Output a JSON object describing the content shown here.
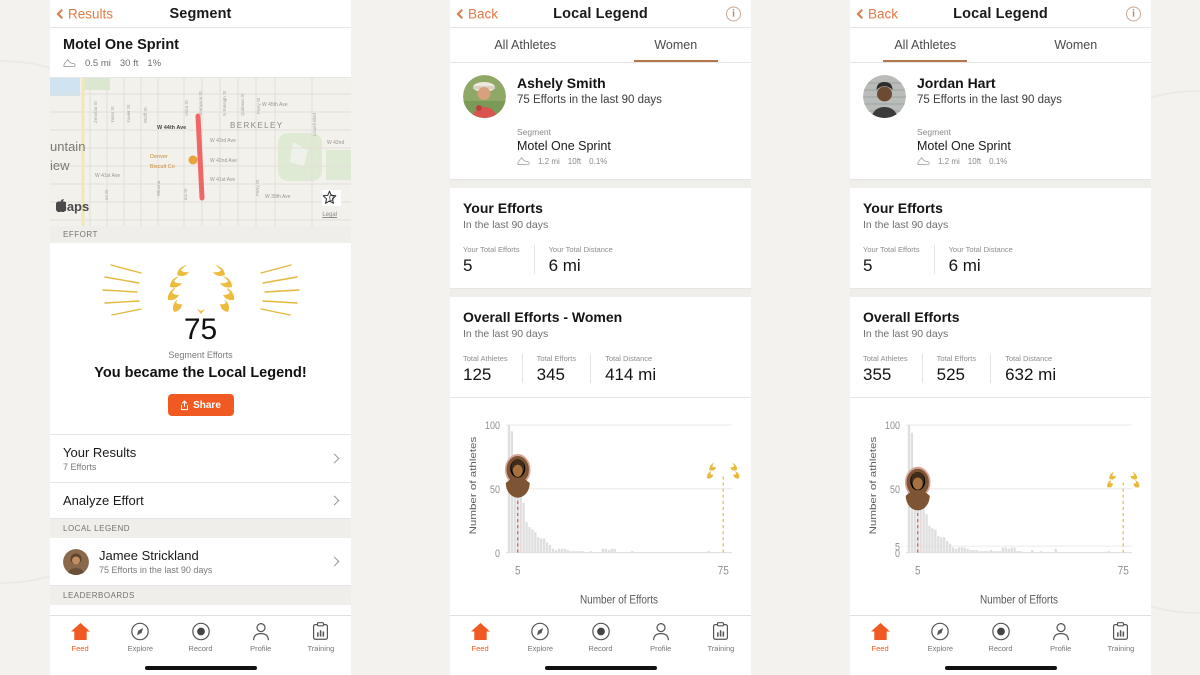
{
  "brand": {
    "orange": "#f05a22",
    "accent_brown": "#b4754a",
    "gold": "#e8b93a",
    "bar_gray": "#dcdcdc"
  },
  "left_panel": {
    "nav": {
      "back_label": "Results",
      "title": "Segment"
    },
    "segment": {
      "name": "Motel One Sprint",
      "distance": "0.5 mi",
      "elevation": "30 ft",
      "grade": "1%"
    },
    "map": {
      "attribution": "Maps",
      "legal": "Legal",
      "star_count": "0",
      "place_label": "BERKELEY",
      "city_label_1": "untain",
      "city_label_2": "iew",
      "poi": "Denver Biscuit Co",
      "streets": [
        "W 45th Ave",
        "W 44th Ave",
        "W 43rd Ave",
        "W 42nd Ave",
        "W 41st Ave",
        "W 39th Ave",
        "W 42nd",
        "Ave"
      ],
      "cross_streets": [
        "Zenobia St",
        "Yates St",
        "Xavier St",
        "Wolff St",
        "Utica St",
        "Tennyson St",
        "N Raleigh St",
        "Quitman St",
        "Perry St",
        "Lowell Blvd",
        "Winona",
        "Perry St",
        "Ves St",
        "Ica St"
      ]
    },
    "effort_header": "EFFORT",
    "trophy": {
      "count": "75",
      "count_label": "Segment Efforts",
      "headline": "You became the Local Legend!",
      "share_label": "Share"
    },
    "rows": [
      {
        "title": "Your Results",
        "sub": "7 Efforts"
      },
      {
        "title": "Analyze Effort",
        "sub": ""
      }
    ],
    "local_legend_header": "LOCAL LEGEND",
    "local_legend": {
      "name": "Jamee Strickland",
      "sub": "75 Efforts in the last 90 days"
    },
    "leaderboards_header": "LEADERBOARDS",
    "tabbar": [
      {
        "label": "Feed",
        "icon": "home-icon",
        "active": true
      },
      {
        "label": "Explore",
        "icon": "compass-icon",
        "active": false
      },
      {
        "label": "Record",
        "icon": "record-icon",
        "active": false
      },
      {
        "label": "Profile",
        "icon": "person-icon",
        "active": false
      },
      {
        "label": "Training",
        "icon": "clipboard-icon",
        "active": false
      }
    ]
  },
  "mid_panel": {
    "nav": {
      "back_label": "Back",
      "title": "Local Legend",
      "info": "i"
    },
    "tabs": [
      {
        "label": "All Athletes",
        "active": false
      },
      {
        "label": "Women",
        "active": true
      }
    ],
    "athlete": {
      "name": "Ashely Smith",
      "sub": "75 Efforts in the last 90 days",
      "segment_label": "Segment",
      "segment_name": "Motel One Sprint",
      "distance": "1.2 mi",
      "elevation": "10ft",
      "grade": "0.1%"
    },
    "your_efforts": {
      "title": "Your Efforts",
      "subtitle": "In the last 90 days",
      "stats": [
        {
          "label": "Your Total Efforts",
          "value": "5"
        },
        {
          "label": "Your Total Distance",
          "value": "6 mi"
        }
      ]
    },
    "overall": {
      "title": "Overall Efforts - Women",
      "subtitle": "In the last 90 days",
      "stats": [
        {
          "label": "Total Athletes",
          "value": "125"
        },
        {
          "label": "Total Efforts",
          "value": "345"
        },
        {
          "label": "Total Distance",
          "value": "414 mi"
        }
      ]
    },
    "tabbar": [
      {
        "label": "Feed",
        "icon": "home-icon",
        "active": true
      },
      {
        "label": "Explore",
        "icon": "compass-icon",
        "active": false
      },
      {
        "label": "Record",
        "icon": "record-icon",
        "active": false
      },
      {
        "label": "Profile",
        "icon": "person-icon",
        "active": false
      },
      {
        "label": "Training",
        "icon": "clipboard-icon",
        "active": false
      }
    ]
  },
  "right_panel": {
    "nav": {
      "back_label": "Back",
      "title": "Local Legend",
      "info": "i"
    },
    "tabs": [
      {
        "label": "All Athletes",
        "active": true
      },
      {
        "label": "Women",
        "active": false
      }
    ],
    "athlete": {
      "name": "Jordan Hart",
      "sub": "75 Efforts in the last 90 days",
      "segment_label": "Segment",
      "segment_name": "Motel One Sprint",
      "distance": "1.2 mi",
      "elevation": "10ft",
      "grade": "0.1%"
    },
    "your_efforts": {
      "title": "Your Efforts",
      "subtitle": "In the last 90 days",
      "stats": [
        {
          "label": "Your Total Efforts",
          "value": "5"
        },
        {
          "label": "Your Total Distance",
          "value": "6 mi"
        }
      ]
    },
    "overall": {
      "title": "Overall Efforts",
      "subtitle": "In the last 90 days",
      "stats": [
        {
          "label": "Total Athletes",
          "value": "355"
        },
        {
          "label": "Total Efforts",
          "value": "525"
        },
        {
          "label": "Total Distance",
          "value": "632 mi"
        }
      ]
    },
    "tabbar": [
      {
        "label": "Feed",
        "icon": "home-icon",
        "active": true
      },
      {
        "label": "Explore",
        "icon": "compass-icon",
        "active": false
      },
      {
        "label": "Record",
        "icon": "record-icon",
        "active": false
      },
      {
        "label": "Profile",
        "icon": "person-icon",
        "active": false
      },
      {
        "label": "Training",
        "icon": "clipboard-icon",
        "active": false
      }
    ]
  },
  "chart_data": [
    {
      "id": "mid-chart",
      "type": "bar",
      "title": "",
      "xlabel": "Number of Efforts",
      "ylabel": "Number of athletes",
      "xticks": [
        "5",
        "75"
      ],
      "xtick_values": [
        5,
        75
      ],
      "yticks": [
        "0",
        "50",
        "100"
      ],
      "ytick_values": [
        0,
        50,
        100
      ],
      "ylim": [
        0,
        105
      ],
      "xlim": [
        1,
        78
      ],
      "yscale": "linear",
      "grid": true,
      "legend": "none",
      "marker_you": {
        "x": 5,
        "y": 65,
        "label": "you-avatar",
        "line_color": "#d9534f",
        "line_style": "dashed"
      },
      "marker_legend": {
        "x": 75,
        "y": 62,
        "label": "laurel-icon",
        "line_color": "#e8b93a",
        "line_style": "dashed"
      },
      "x": [
        2,
        3,
        4,
        5,
        6,
        7,
        8,
        9,
        10,
        11,
        12,
        13,
        14,
        15,
        16,
        17,
        18,
        19,
        20,
        21,
        22,
        23,
        24,
        25,
        26,
        27,
        28,
        29,
        30,
        31,
        32,
        33,
        34,
        35,
        36,
        37,
        38,
        39,
        40,
        41,
        42,
        43,
        44,
        45,
        46,
        47,
        48,
        49,
        50,
        51,
        52,
        53,
        54,
        55,
        56,
        57,
        58,
        59,
        60,
        61,
        62,
        63,
        64,
        65,
        66,
        67,
        68,
        69,
        70,
        71,
        72,
        73,
        74,
        75
      ],
      "values": [
        100,
        95,
        62,
        54,
        54,
        39,
        24,
        20,
        18,
        16,
        12,
        11,
        11,
        8,
        6,
        3,
        2,
        3,
        3,
        3,
        2,
        1,
        1,
        1,
        1,
        1,
        0,
        0,
        1,
        0,
        0,
        0,
        3,
        3,
        2,
        3,
        3,
        0,
        0,
        0,
        0,
        0,
        1,
        0,
        0,
        0,
        0,
        0,
        0,
        0,
        0,
        0,
        0,
        0,
        0,
        0,
        0,
        0,
        0,
        0,
        0,
        0,
        0,
        0,
        0,
        0,
        0,
        0,
        1,
        0,
        0,
        0,
        0,
        0
      ]
    },
    {
      "id": "right-chart",
      "type": "bar",
      "title": "",
      "xlabel": "Number of Efforts",
      "ylabel": "Number of athletes",
      "xticks": [
        "5",
        "75"
      ],
      "xtick_values": [
        5,
        75
      ],
      "yticks": [
        "0",
        "5",
        "50",
        "100"
      ],
      "ytick_values": [
        0,
        5,
        50,
        100
      ],
      "ylim": [
        0,
        105
      ],
      "xlim": [
        1,
        78
      ],
      "yscale": "linear",
      "grid": true,
      "legend": "none",
      "marker_you": {
        "x": 5,
        "y": 55,
        "label": "you-avatar",
        "line_color": "#d9534f",
        "line_style": "dashed"
      },
      "marker_legend": {
        "x": 75,
        "y": 55,
        "label": "laurel-icon",
        "line_color": "#e8b93a",
        "line_style": "dashed"
      },
      "x": [
        2,
        3,
        4,
        5,
        6,
        7,
        8,
        9,
        10,
        11,
        12,
        13,
        14,
        15,
        16,
        17,
        18,
        19,
        20,
        21,
        22,
        23,
        24,
        25,
        26,
        27,
        28,
        29,
        30,
        31,
        32,
        33,
        34,
        35,
        36,
        37,
        38,
        39,
        40,
        41,
        42,
        43,
        44,
        45,
        46,
        47,
        48,
        49,
        50,
        51,
        52,
        53,
        54,
        55,
        56,
        57,
        58,
        59,
        60,
        61,
        62,
        63,
        64,
        65,
        66,
        67,
        68,
        69,
        70,
        71,
        72,
        73,
        74,
        75
      ],
      "values": [
        100,
        94,
        60,
        55,
        55,
        40,
        30,
        21,
        19,
        18,
        13,
        12,
        12,
        9,
        7,
        4,
        3,
        4,
        4,
        4,
        3,
        2,
        2,
        2,
        1,
        1,
        1,
        1,
        2,
        1,
        1,
        1,
        4,
        4,
        3,
        4,
        4,
        1,
        1,
        0,
        0,
        0,
        2,
        0,
        0,
        1,
        0,
        0,
        0,
        0,
        3,
        0,
        0,
        0,
        0,
        0,
        0,
        0,
        0,
        0,
        0,
        0,
        0,
        0,
        0,
        0,
        0,
        0,
        1,
        0,
        0,
        0,
        0,
        0
      ]
    }
  ]
}
